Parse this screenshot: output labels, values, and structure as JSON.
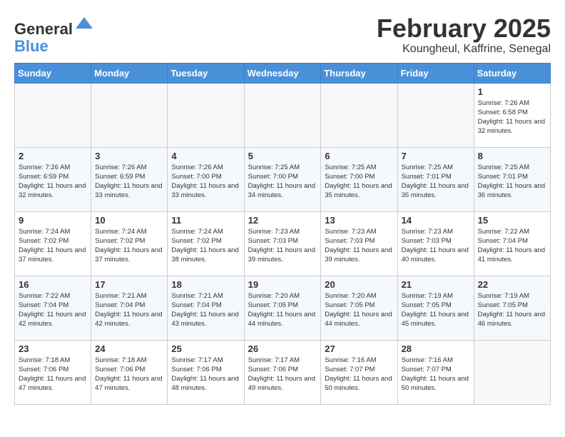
{
  "logo": {
    "general": "General",
    "blue": "Blue"
  },
  "header": {
    "month": "February 2025",
    "location": "Koungheul, Kaffrine, Senegal"
  },
  "weekdays": [
    "Sunday",
    "Monday",
    "Tuesday",
    "Wednesday",
    "Thursday",
    "Friday",
    "Saturday"
  ],
  "weeks": [
    [
      {
        "day": "",
        "info": ""
      },
      {
        "day": "",
        "info": ""
      },
      {
        "day": "",
        "info": ""
      },
      {
        "day": "",
        "info": ""
      },
      {
        "day": "",
        "info": ""
      },
      {
        "day": "",
        "info": ""
      },
      {
        "day": "1",
        "info": "Sunrise: 7:26 AM\nSunset: 6:58 PM\nDaylight: 11 hours and 32 minutes."
      }
    ],
    [
      {
        "day": "2",
        "info": "Sunrise: 7:26 AM\nSunset: 6:59 PM\nDaylight: 11 hours and 32 minutes."
      },
      {
        "day": "3",
        "info": "Sunrise: 7:26 AM\nSunset: 6:59 PM\nDaylight: 11 hours and 33 minutes."
      },
      {
        "day": "4",
        "info": "Sunrise: 7:26 AM\nSunset: 7:00 PM\nDaylight: 11 hours and 33 minutes."
      },
      {
        "day": "5",
        "info": "Sunrise: 7:25 AM\nSunset: 7:00 PM\nDaylight: 11 hours and 34 minutes."
      },
      {
        "day": "6",
        "info": "Sunrise: 7:25 AM\nSunset: 7:00 PM\nDaylight: 11 hours and 35 minutes."
      },
      {
        "day": "7",
        "info": "Sunrise: 7:25 AM\nSunset: 7:01 PM\nDaylight: 11 hours and 35 minutes."
      },
      {
        "day": "8",
        "info": "Sunrise: 7:25 AM\nSunset: 7:01 PM\nDaylight: 11 hours and 36 minutes."
      }
    ],
    [
      {
        "day": "9",
        "info": "Sunrise: 7:24 AM\nSunset: 7:02 PM\nDaylight: 11 hours and 37 minutes."
      },
      {
        "day": "10",
        "info": "Sunrise: 7:24 AM\nSunset: 7:02 PM\nDaylight: 11 hours and 37 minutes."
      },
      {
        "day": "11",
        "info": "Sunrise: 7:24 AM\nSunset: 7:02 PM\nDaylight: 11 hours and 38 minutes."
      },
      {
        "day": "12",
        "info": "Sunrise: 7:23 AM\nSunset: 7:03 PM\nDaylight: 11 hours and 39 minutes."
      },
      {
        "day": "13",
        "info": "Sunrise: 7:23 AM\nSunset: 7:03 PM\nDaylight: 11 hours and 39 minutes."
      },
      {
        "day": "14",
        "info": "Sunrise: 7:23 AM\nSunset: 7:03 PM\nDaylight: 11 hours and 40 minutes."
      },
      {
        "day": "15",
        "info": "Sunrise: 7:22 AM\nSunset: 7:04 PM\nDaylight: 11 hours and 41 minutes."
      }
    ],
    [
      {
        "day": "16",
        "info": "Sunrise: 7:22 AM\nSunset: 7:04 PM\nDaylight: 11 hours and 42 minutes."
      },
      {
        "day": "17",
        "info": "Sunrise: 7:21 AM\nSunset: 7:04 PM\nDaylight: 11 hours and 42 minutes."
      },
      {
        "day": "18",
        "info": "Sunrise: 7:21 AM\nSunset: 7:04 PM\nDaylight: 11 hours and 43 minutes."
      },
      {
        "day": "19",
        "info": "Sunrise: 7:20 AM\nSunset: 7:05 PM\nDaylight: 11 hours and 44 minutes."
      },
      {
        "day": "20",
        "info": "Sunrise: 7:20 AM\nSunset: 7:05 PM\nDaylight: 11 hours and 44 minutes."
      },
      {
        "day": "21",
        "info": "Sunrise: 7:19 AM\nSunset: 7:05 PM\nDaylight: 11 hours and 45 minutes."
      },
      {
        "day": "22",
        "info": "Sunrise: 7:19 AM\nSunset: 7:05 PM\nDaylight: 11 hours and 46 minutes."
      }
    ],
    [
      {
        "day": "23",
        "info": "Sunrise: 7:18 AM\nSunset: 7:06 PM\nDaylight: 11 hours and 47 minutes."
      },
      {
        "day": "24",
        "info": "Sunrise: 7:18 AM\nSunset: 7:06 PM\nDaylight: 11 hours and 47 minutes."
      },
      {
        "day": "25",
        "info": "Sunrise: 7:17 AM\nSunset: 7:06 PM\nDaylight: 11 hours and 48 minutes."
      },
      {
        "day": "26",
        "info": "Sunrise: 7:17 AM\nSunset: 7:06 PM\nDaylight: 11 hours and 49 minutes."
      },
      {
        "day": "27",
        "info": "Sunrise: 7:16 AM\nSunset: 7:07 PM\nDaylight: 11 hours and 50 minutes."
      },
      {
        "day": "28",
        "info": "Sunrise: 7:16 AM\nSunset: 7:07 PM\nDaylight: 11 hours and 50 minutes."
      },
      {
        "day": "",
        "info": ""
      }
    ]
  ]
}
